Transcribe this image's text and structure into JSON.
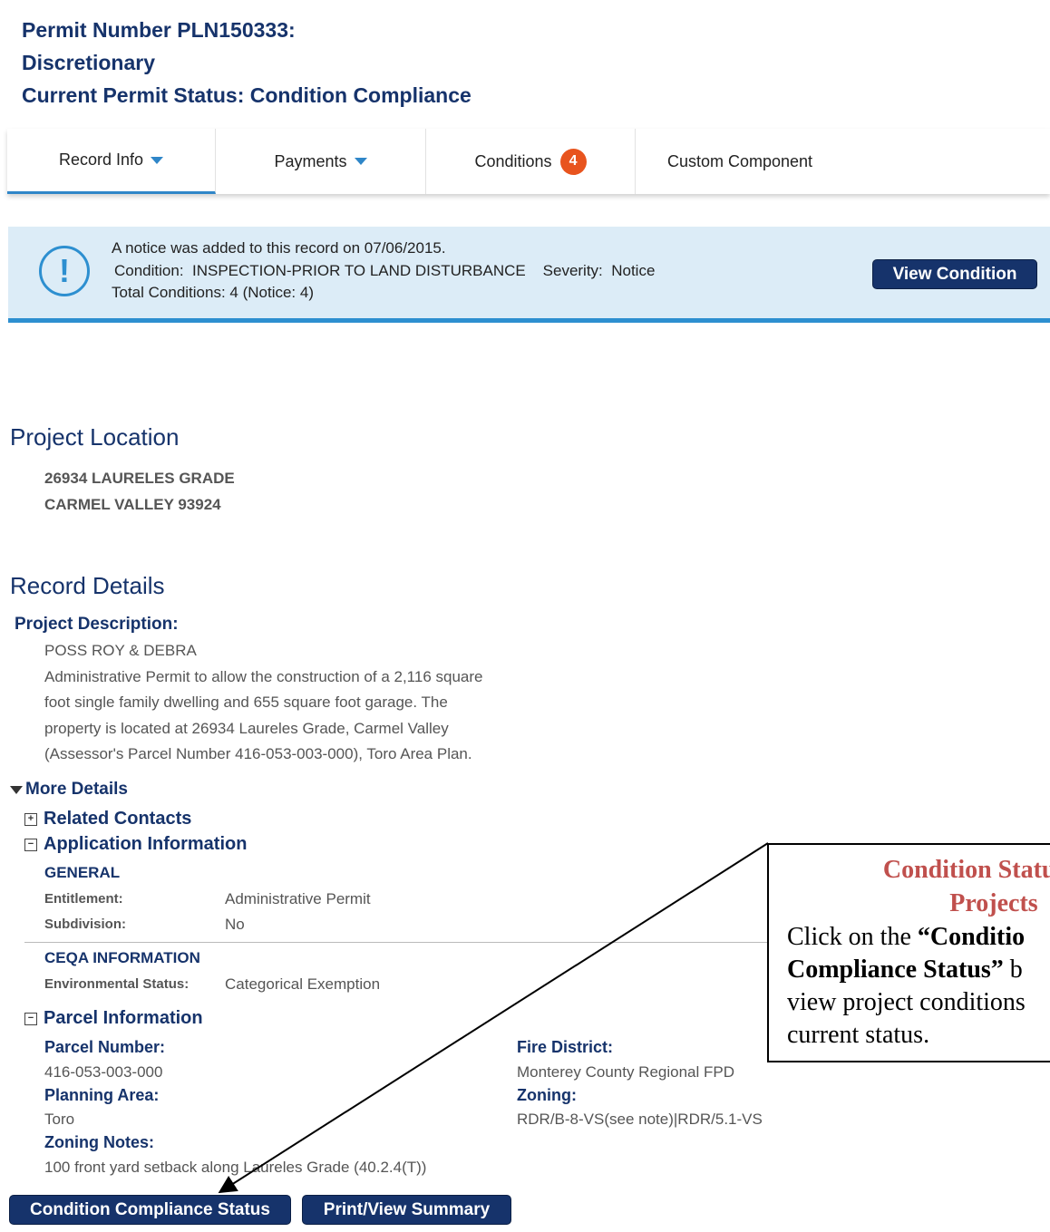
{
  "header": {
    "permit_line": "Permit Number PLN150333:",
    "type_line": "Discretionary",
    "status_line": "Current Permit Status: Condition Compliance"
  },
  "tabs": [
    {
      "label": "Record Info",
      "active": true
    },
    {
      "label": "Payments"
    },
    {
      "label": "Conditions",
      "badge": "4"
    },
    {
      "label": "Custom Component"
    }
  ],
  "notice": {
    "line1": "A notice was added to this record on 07/06/2015.",
    "line2": "Condition:  INSPECTION-PRIOR TO LAND DISTURBANCE    Severity:  Notice",
    "line3": "Total Conditions: 4  (Notice: 4)",
    "button": "View Condition",
    "icon": "exclamation-circle-icon"
  },
  "location": {
    "heading": "Project Location",
    "address1": "26934 LAURELES GRADE",
    "address2": "CARMEL VALLEY 93924"
  },
  "record_details": {
    "heading": "Record Details",
    "desc_label": "Project Description:",
    "owner": "POSS ROY & DEBRA",
    "desc_lines": [
      "Administrative Permit to allow the construction of a 2,116 square",
      "foot single family dwelling and 655 square foot garage. The",
      "property is located at 26934 Laureles Grade, Carmel Valley",
      "(Assessor's Parcel Number 416-053-003-000), Toro Area Plan."
    ],
    "more_details": "More Details",
    "related_contacts": "Related Contacts",
    "application_info": "Application Information",
    "general": "GENERAL",
    "entitlement_label": "Entitlement:",
    "entitlement_value": "Administrative Permit",
    "subdivision_label": "Subdivision:",
    "subdivision_value": "No",
    "ceqa": "CEQA INFORMATION",
    "env_label": "Environmental Status:",
    "env_value": "Categorical Exemption",
    "parcel_info": "Parcel Information",
    "parcel_number_label": "Parcel Number:",
    "parcel_number_value": "416-053-003-000",
    "planning_area_label": "Planning Area:",
    "planning_area_value": "Toro",
    "zoning_notes_label": "Zoning Notes:",
    "zoning_notes_value": "100 front yard setback along Laureles Grade (40.2.4(T))",
    "fire_district_label": "Fire District:",
    "fire_district_value": "Monterey County Regional FPD",
    "zoning_label": "Zoning:",
    "zoning_value": "RDR/B-8-VS(see note)|RDR/5.1-VS"
  },
  "buttons": {
    "condition_compliance": "Condition Compliance Status",
    "print_view": "Print/View Summary"
  },
  "callout": {
    "title1": "Condition Status for",
    "title2": "Projects",
    "line1_pre": "Click on the ",
    "line1_bold": "“Conditio",
    "line2_bold": "Compliance Status”",
    "line2_post": " b",
    "line3": "view project conditions",
    "line4": "current status."
  }
}
